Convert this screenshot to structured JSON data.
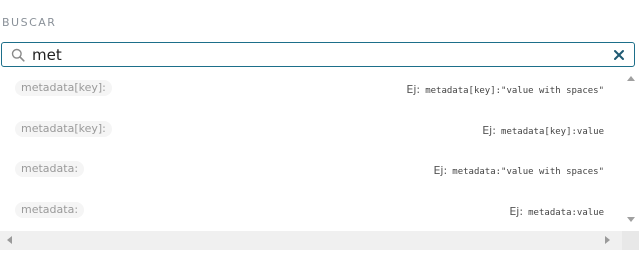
{
  "search": {
    "label": "BUSCAR",
    "value": "met",
    "placeholder": ""
  },
  "icons": {
    "search": "search-icon",
    "clear": "close-icon"
  },
  "colors": {
    "input_border": "#1d6f8a",
    "clear_icon": "#1f5a73",
    "chip_bg": "#f5f5f5"
  },
  "suggestions": [
    {
      "chip": "metadata[key]:",
      "example_label": "Ej:",
      "example_code": "metadata[key]:\"value with spaces\""
    },
    {
      "chip": "metadata[key]:",
      "example_label": "Ej:",
      "example_code": "metadata[key]:value"
    },
    {
      "chip": "metadata:",
      "example_label": "Ej:",
      "example_code": "metadata:\"value with spaces\""
    },
    {
      "chip": "metadata:",
      "example_label": "Ej:",
      "example_code": "metadata:value"
    }
  ]
}
